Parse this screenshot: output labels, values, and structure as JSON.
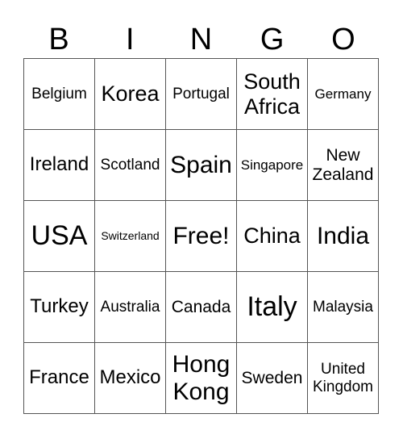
{
  "header": [
    "B",
    "I",
    "N",
    "G",
    "O"
  ],
  "cells": [
    "Belgium",
    "Korea",
    "Portugal",
    "South Africa",
    "Germany",
    "Ireland",
    "Scotland",
    "Spain",
    "Singapore",
    "New Zealand",
    "USA",
    "Switzerland",
    "Free!",
    "China",
    "India",
    "Turkey",
    "Australia",
    "Canada",
    "Italy",
    "Malaysia",
    "France",
    "Mexico",
    "Hong Kong",
    "Sweden",
    "United Kingdom"
  ]
}
